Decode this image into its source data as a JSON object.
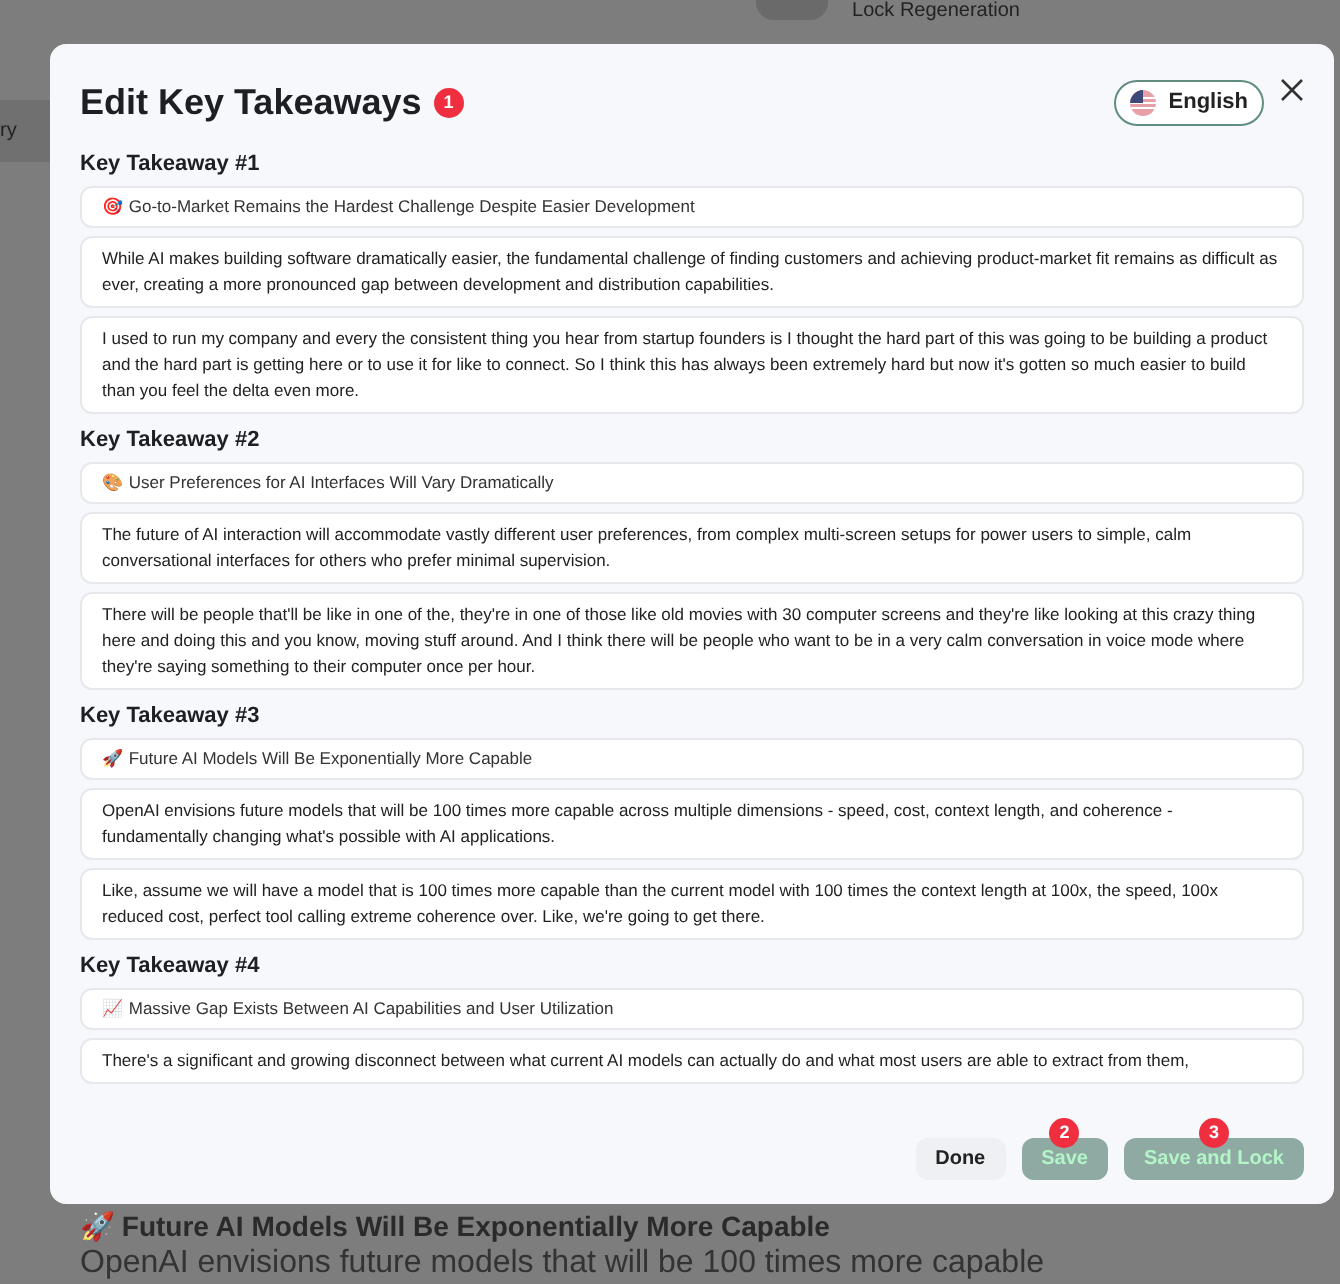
{
  "background": {
    "sidebar_item": "ry",
    "lock_toggle": {
      "label": "Lock Regeneration",
      "on": false
    },
    "heading": "🚀 Future AI Models Will Be Exponentially More Capable",
    "paragraph": "OpenAI envisions future models that will be 100 times more capable"
  },
  "dialog": {
    "title": "Edit Key Takeaways",
    "title_badge": "1",
    "language": "English",
    "takeaways": [
      {
        "label": "Key Takeaway #1",
        "title": "🎯 Go-to-Market Remains the Hardest Challenge Despite Easier Development",
        "summary": "While AI makes building software dramatically easier, the fundamental challenge of finding customers and achieving product-market fit remains as difficult as ever, creating a more pronounced gap between development and distribution capabilities.",
        "quote": "I used to run my company and every the consistent thing you hear from startup founders is I thought the hard part of this was going to be building a product and the hard part is getting here or to use it for like to connect. So I think this has always been extremely hard but now it's gotten so much easier to build than you feel the delta even more."
      },
      {
        "label": "Key Takeaway #2",
        "title": "🎨 User Preferences for AI Interfaces Will Vary Dramatically",
        "summary": "The future of AI interaction will accommodate vastly different user preferences, from complex multi-screen setups for power users to simple, calm conversational interfaces for others who prefer minimal supervision.",
        "quote": "There will be people that'll be like in one of the, they're in one of those like old movies with 30 computer screens and they're like looking at this crazy thing here and doing this and you know, moving stuff around. And I think there will be people who want to be in a very calm conversation in voice mode where they're saying something to their computer once per hour."
      },
      {
        "label": "Key Takeaway #3",
        "title": "🚀 Future AI Models Will Be Exponentially More Capable",
        "summary": "OpenAI envisions future models that will be 100 times more capable across multiple dimensions - speed, cost, context length, and coherence - fundamentally changing what's possible with AI applications.",
        "quote": "Like, assume we will have a model that is 100 times more capable than the current model with 100 times the context length at 100x, the speed, 100x reduced cost, perfect tool calling extreme coherence over. Like, we're going to get there."
      },
      {
        "label": "Key Takeaway #4",
        "title": "📈 Massive Gap Exists Between AI Capabilities and User Utilization",
        "summary": "There's a significant and growing disconnect between what current AI models can actually do and what most users are able to extract from them,"
      }
    ],
    "buttons": [
      {
        "kind": "plain",
        "label": "Done",
        "disabled": false
      },
      {
        "kind": "primary",
        "label": "Save",
        "badge": "2",
        "disabled": true
      },
      {
        "kind": "primary",
        "label": "Save and Lock",
        "badge": "3",
        "disabled": true
      }
    ]
  }
}
